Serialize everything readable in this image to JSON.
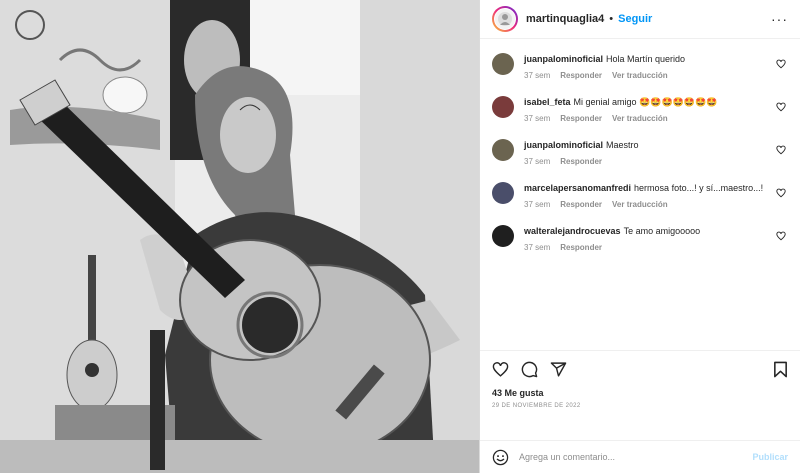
{
  "header": {
    "username": "martinquaglia4",
    "separator": "•",
    "follow_label": "Seguir",
    "more_label": "···"
  },
  "photo": {
    "description_icon": "photo-placeholder",
    "tones": [
      "#f2f2f2",
      "#cfcfcf",
      "#8a8a8a",
      "#2b2b2b",
      "#111111"
    ]
  },
  "comments": [
    {
      "user": "juanpalominoficial",
      "text": "Hola Martín querido",
      "time": "37 sem",
      "reply": "Responder",
      "translate": "Ver traducción",
      "avatar_color": "#6b6450"
    },
    {
      "user": "isabel_feta",
      "text": "Mi genial amigo 🤩🤩🤩🤩🤩🤩🤩",
      "time": "37 sem",
      "reply": "Responder",
      "translate": "Ver traducción",
      "avatar_color": "#7a3b3b"
    },
    {
      "user": "juanpalominoficial",
      "text": "Maestro",
      "time": "37 sem",
      "reply": "Responder",
      "translate": "",
      "avatar_color": "#6b6450"
    },
    {
      "user": "marcelapersanomanfredi",
      "text": "hermosa foto...! y sí...maestro...!",
      "time": "37 sem",
      "reply": "Responder",
      "translate": "Ver traducción",
      "avatar_color": "#4a4e6a"
    },
    {
      "user": "walteralejandrocuevas",
      "text": "Te amo amigooooo",
      "time": "37 sem",
      "reply": "Responder",
      "translate": "",
      "avatar_color": "#1f1f1f"
    }
  ],
  "actions": {
    "icons": [
      "heart-icon",
      "comment-icon",
      "share-icon",
      "bookmark-icon"
    ],
    "likes": "43 Me gusta",
    "date": "29 DE NOVIEMBRE DE 2022"
  },
  "add_comment": {
    "placeholder": "Agrega un comentario...",
    "publish_label": "Publicar"
  },
  "colors": {
    "accent": "#0095f6",
    "publish_disabled": "#b2dffc",
    "muted": "#8e8e8e",
    "text": "#262626"
  }
}
